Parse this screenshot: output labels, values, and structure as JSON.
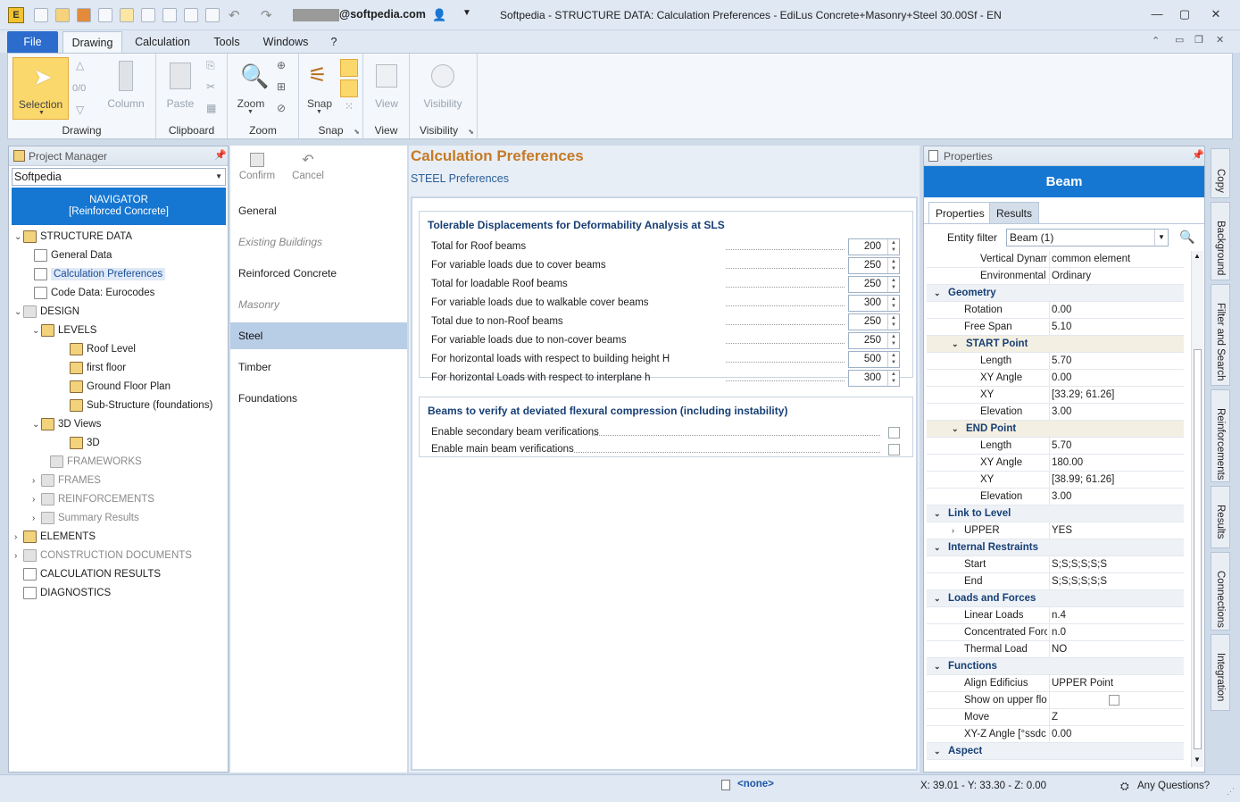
{
  "window": {
    "title": "Softpedia  -  STRUCTURE DATA: Calculation Preferences - EdiLus Concrete+Masonry+Steel 30.00Sf - EN",
    "user": "@softpedia.com"
  },
  "ribbon": {
    "tabs": [
      "File",
      "Drawing",
      "Calculation",
      "Tools",
      "Windows",
      "?"
    ],
    "groups": {
      "drawing": {
        "label": "Drawing",
        "selection": "Selection",
        "counter": "0/0",
        "column": "Column"
      },
      "clipboard": {
        "label": "Clipboard",
        "paste": "Paste"
      },
      "zoom": {
        "label": "Zoom",
        "zoom": "Zoom"
      },
      "snap": {
        "label": "Snap",
        "snap": "Snap"
      },
      "view": {
        "label": "View",
        "view": "View"
      },
      "visibility": {
        "label": "Visibility",
        "visibility": "Visibility"
      }
    }
  },
  "project_manager": {
    "title": "Project Manager",
    "combo_value": "Softpedia",
    "navigator_line1": "NAVIGATOR",
    "navigator_line2": "[Reinforced Concrete]",
    "tree": [
      "STRUCTURE DATA",
      "General Data",
      "Calculation Preferences",
      "Code Data: Eurocodes",
      "DESIGN",
      "LEVELS",
      "Roof Level",
      "first floor",
      "Ground Floor Plan",
      "Sub-Structure (foundations)",
      "3D Views",
      "3D",
      "FRAMEWORKS",
      "FRAMES",
      "REINFORCEMENTS",
      "Summary Results",
      "ELEMENTS",
      "CONSTRUCTION DOCUMENTS",
      "CALCULATION RESULTS",
      "DIAGNOSTICS"
    ]
  },
  "middle": {
    "confirm": "Confirm",
    "cancel": "Cancel",
    "items": [
      "General",
      "Existing Buildings",
      "Reinforced Concrete",
      "Masonry",
      "Steel",
      "Timber",
      "Foundations"
    ]
  },
  "content": {
    "title": "Calculation Preferences",
    "subtitle": "STEEL Preferences",
    "group1": {
      "title": "Tolerable Displacements for Deformability Analysis at SLS",
      "rows": [
        {
          "label": "Total for Roof beams",
          "value": "200"
        },
        {
          "label": "For variable loads due to cover beams",
          "value": "250"
        },
        {
          "label": "Total for loadable Roof beams",
          "value": "250"
        },
        {
          "label": "For variable loads due to walkable cover beams",
          "value": "300"
        },
        {
          "label": "Total due to non-Roof beams",
          "value": "250"
        },
        {
          "label": "For variable loads due to non-cover beams",
          "value": "250"
        },
        {
          "label": "For horizontal loads with respect to building height H",
          "value": "500"
        },
        {
          "label": "For horizontal Loads with respect to interplane h",
          "value": "300"
        }
      ]
    },
    "group2": {
      "title": "Beams to verify at deviated flexural compression (including instability)",
      "rows": [
        "Enable secondary beam verifications",
        "Enable main beam verifications"
      ]
    }
  },
  "properties": {
    "title": "Properties",
    "header": "Beam",
    "tabs": [
      "Properties",
      "Results"
    ],
    "entity_filter_label": "Entity filter",
    "entity_filter_value": "Beam (1)",
    "grid": [
      {
        "k": "Vertical Dynam",
        "v": "common element"
      },
      {
        "k": "Environmental",
        "v": "Ordinary"
      },
      {
        "k": "Geometry",
        "cat": true
      },
      {
        "k": "Rotation",
        "v": "0.00"
      },
      {
        "k": "Free Span",
        "v": "5.10"
      },
      {
        "k": "START Point",
        "sub": true
      },
      {
        "k": "Length",
        "v": "5.70"
      },
      {
        "k": "XY Angle",
        "v": "0.00"
      },
      {
        "k": "XY",
        "v": "[33.29; 61.26]"
      },
      {
        "k": "Elevation",
        "v": "3.00"
      },
      {
        "k": "END Point",
        "sub": true
      },
      {
        "k": "Length",
        "v": "5.70"
      },
      {
        "k": "XY Angle",
        "v": "180.00"
      },
      {
        "k": "XY",
        "v": "[38.99; 61.26]"
      },
      {
        "k": "Elevation",
        "v": "3.00"
      },
      {
        "k": "Link to Level",
        "cat": true
      },
      {
        "k": "UPPER",
        "v": "YES"
      },
      {
        "k": "Internal Restraints",
        "cat": true
      },
      {
        "k": "Start",
        "v": "S;S;S;S;S;S"
      },
      {
        "k": "End",
        "v": "S;S;S;S;S;S"
      },
      {
        "k": "Loads and Forces",
        "cat": true
      },
      {
        "k": "Linear Loads",
        "v": "n.4"
      },
      {
        "k": "Concentrated Forc",
        "v": "n.0"
      },
      {
        "k": "Thermal Load",
        "v": "NO"
      },
      {
        "k": "Functions",
        "cat": true
      },
      {
        "k": "Align Edificius",
        "v": "UPPER Point"
      },
      {
        "k": "Show on upper floo",
        "v": ""
      },
      {
        "k": "Move",
        "v": "Z"
      },
      {
        "k": "XY-Z Angle  [°ssdc",
        "v": "0.00"
      },
      {
        "k": "Aspect",
        "cat": true
      }
    ]
  },
  "side_tabs": [
    "Copy",
    "Background",
    "Filter and Search",
    "Reinforcements",
    "Results",
    "Connections",
    "Integration"
  ],
  "status": {
    "selection": "<none>",
    "coords": "X: 39.01 - Y: 33.30 - Z: 0.00",
    "help": "Any Questions?"
  }
}
